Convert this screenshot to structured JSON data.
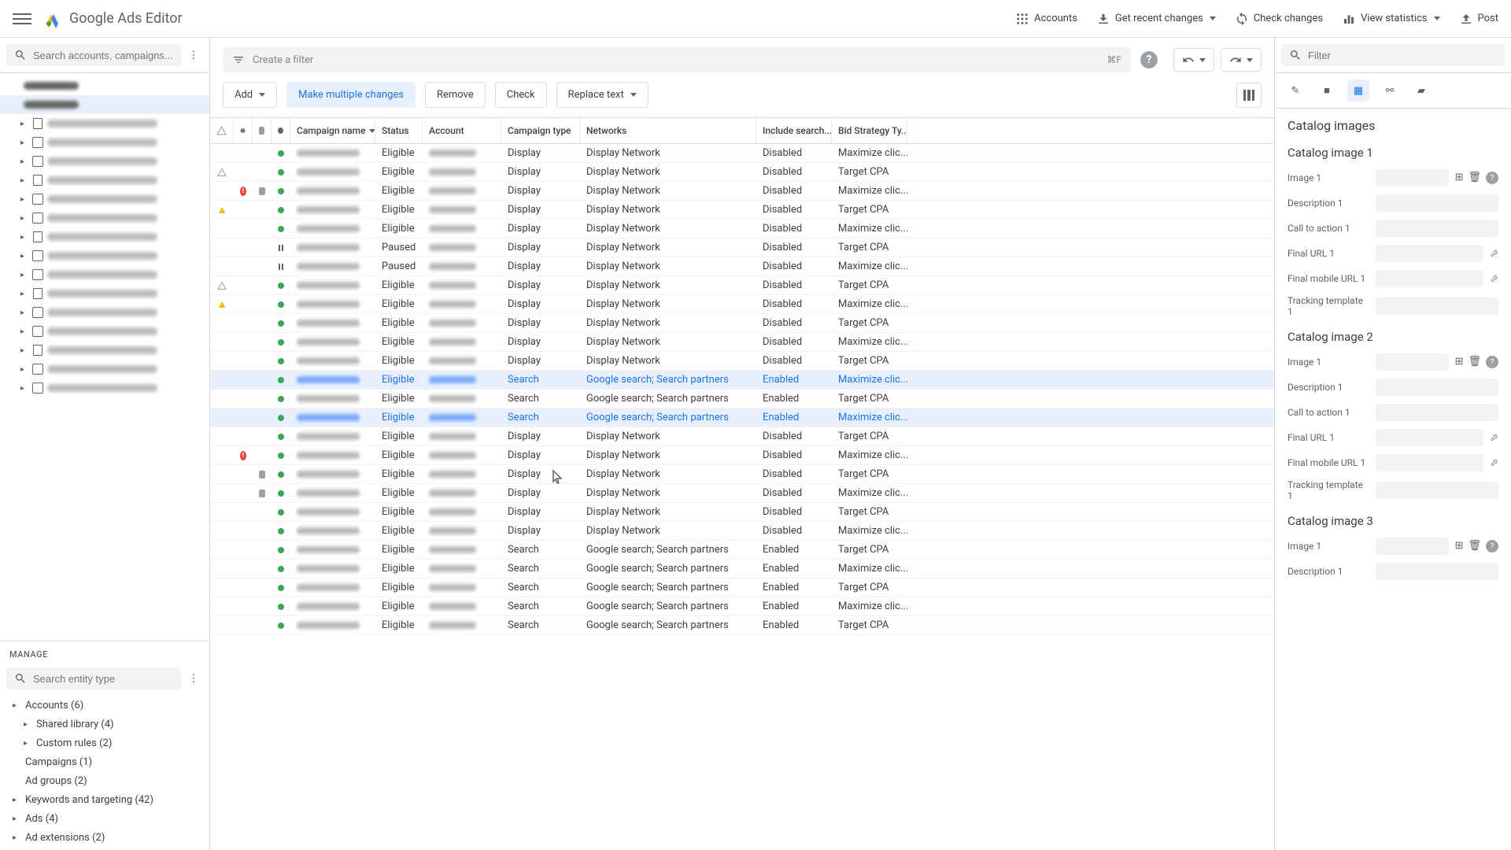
{
  "header": {
    "app_title": "Google Ads Editor",
    "accounts": "Accounts",
    "get_recent": "Get recent changes",
    "check_changes": "Check changes",
    "view_stats": "View statistics",
    "post": "Post"
  },
  "sidebar": {
    "search_placeholder": "Search accounts, campaigns...",
    "manage_header": "MANAGE",
    "entity_search_placeholder": "Search entity type",
    "items": [
      {
        "label": "Accounts (6)",
        "expandable": true
      },
      {
        "label": "Shared library (4)",
        "child": true,
        "expandable": true
      },
      {
        "label": "Custom rules (2)",
        "child": true,
        "expandable": true
      },
      {
        "label": "Campaigns (1)",
        "expandable": false
      },
      {
        "label": "Ad groups (2)",
        "expandable": false
      },
      {
        "label": "Keywords and targeting (42)",
        "expandable": true
      },
      {
        "label": "Ads (4)",
        "expandable": true
      },
      {
        "label": "Ad extensions (2)",
        "expandable": true
      }
    ]
  },
  "filter": {
    "placeholder": "Create a filter",
    "shortcut": "⌘F"
  },
  "toolbar": {
    "add": "Add",
    "make_multiple": "Make multiple changes",
    "remove": "Remove",
    "check": "Check",
    "replace": "Replace text"
  },
  "columns": {
    "campaign_name": "Campaign name",
    "status": "Status",
    "account": "Account",
    "campaign_type": "Campaign type",
    "networks": "Networks",
    "include_search": "Include search...",
    "bid_strategy": "Bid Strategy Ty..."
  },
  "rows": [
    {
      "warn": "",
      "err": "",
      "comment": "",
      "state": "dot",
      "status": "Eligible",
      "type": "Display",
      "networks": "Display Network",
      "search": "Disabled",
      "bid": "Maximize clic...",
      "selected": false
    },
    {
      "warn": "outline",
      "err": "",
      "comment": "",
      "state": "dot",
      "status": "Eligible",
      "type": "Display",
      "networks": "Display Network",
      "search": "Disabled",
      "bid": "Target CPA",
      "selected": false
    },
    {
      "warn": "",
      "err": "err",
      "comment": "yes",
      "state": "dot",
      "status": "Eligible",
      "type": "Display",
      "networks": "Display Network",
      "search": "Disabled",
      "bid": "Maximize clic...",
      "selected": false
    },
    {
      "warn": "warn",
      "err": "",
      "comment": "",
      "state": "dot",
      "status": "Eligible",
      "type": "Display",
      "networks": "Display Network",
      "search": "Disabled",
      "bid": "Target CPA",
      "selected": false
    },
    {
      "warn": "",
      "err": "",
      "comment": "",
      "state": "dot",
      "status": "Eligible",
      "type": "Display",
      "networks": "Display Network",
      "search": "Disabled",
      "bid": "Maximize clic...",
      "selected": false
    },
    {
      "warn": "",
      "err": "",
      "comment": "",
      "state": "pause",
      "status": "Paused",
      "type": "Display",
      "networks": "Display Network",
      "search": "Disabled",
      "bid": "Target CPA",
      "selected": false
    },
    {
      "warn": "",
      "err": "",
      "comment": "",
      "state": "pause",
      "status": "Paused",
      "type": "Display",
      "networks": "Display Network",
      "search": "Disabled",
      "bid": "Maximize clic...",
      "selected": false
    },
    {
      "warn": "outline",
      "err": "",
      "comment": "",
      "state": "dot",
      "status": "Eligible",
      "type": "Display",
      "networks": "Display Network",
      "search": "Disabled",
      "bid": "Target CPA",
      "selected": false
    },
    {
      "warn": "warn",
      "err": "",
      "comment": "",
      "state": "dot",
      "status": "Eligible",
      "type": "Display",
      "networks": "Display Network",
      "search": "Disabled",
      "bid": "Maximize clic...",
      "selected": false
    },
    {
      "warn": "",
      "err": "",
      "comment": "",
      "state": "dot",
      "status": "Eligible",
      "type": "Display",
      "networks": "Display Network",
      "search": "Disabled",
      "bid": "Target CPA",
      "selected": false
    },
    {
      "warn": "",
      "err": "",
      "comment": "",
      "state": "dot",
      "status": "Eligible",
      "type": "Display",
      "networks": "Display Network",
      "search": "Disabled",
      "bid": "Maximize clic...",
      "selected": false
    },
    {
      "warn": "",
      "err": "",
      "comment": "",
      "state": "dot",
      "status": "Eligible",
      "type": "Display",
      "networks": "Display Network",
      "search": "Disabled",
      "bid": "Target CPA",
      "selected": false
    },
    {
      "warn": "",
      "err": "",
      "comment": "",
      "state": "dot",
      "status": "Eligible",
      "type": "Search",
      "networks": "Google search; Search partners",
      "search": "Enabled",
      "bid": "Maximize clic...",
      "selected": true
    },
    {
      "warn": "",
      "err": "",
      "comment": "",
      "state": "dot",
      "status": "Eligible",
      "type": "Search",
      "networks": "Google search; Search partners",
      "search": "Enabled",
      "bid": "Target CPA",
      "selected": false
    },
    {
      "warn": "",
      "err": "",
      "comment": "",
      "state": "dot",
      "status": "Eligible",
      "type": "Search",
      "networks": "Google search; Search partners",
      "search": "Enabled",
      "bid": "Maximize clic...",
      "selected": true
    },
    {
      "warn": "",
      "err": "",
      "comment": "",
      "state": "dot",
      "status": "Eligible",
      "type": "Display",
      "networks": "Display Network",
      "search": "Disabled",
      "bid": "Target CPA",
      "selected": false
    },
    {
      "warn": "",
      "err": "err",
      "comment": "",
      "state": "dot",
      "status": "Eligible",
      "type": "Display",
      "networks": "Display Network",
      "search": "Disabled",
      "bid": "Maximize clic...",
      "selected": false
    },
    {
      "warn": "",
      "err": "",
      "comment": "yes",
      "state": "dot",
      "status": "Eligible",
      "type": "Display",
      "networks": "Display Network",
      "search": "Disabled",
      "bid": "Target CPA",
      "selected": false
    },
    {
      "warn": "",
      "err": "",
      "comment": "yes",
      "state": "dot",
      "status": "Eligible",
      "type": "Display",
      "networks": "Display Network",
      "search": "Disabled",
      "bid": "Maximize clic...",
      "selected": false
    },
    {
      "warn": "",
      "err": "",
      "comment": "",
      "state": "dot",
      "status": "Eligible",
      "type": "Display",
      "networks": "Display Network",
      "search": "Disabled",
      "bid": "Target CPA",
      "selected": false
    },
    {
      "warn": "",
      "err": "",
      "comment": "",
      "state": "dot",
      "status": "Eligible",
      "type": "Display",
      "networks": "Display Network",
      "search": "Disabled",
      "bid": "Maximize clic...",
      "selected": false
    },
    {
      "warn": "",
      "err": "",
      "comment": "",
      "state": "dot",
      "status": "Eligible",
      "type": "Search",
      "networks": "Google search; Search partners",
      "search": "Enabled",
      "bid": "Target CPA",
      "selected": false
    },
    {
      "warn": "",
      "err": "",
      "comment": "",
      "state": "dot",
      "status": "Eligible",
      "type": "Search",
      "networks": "Google search; Search partners",
      "search": "Enabled",
      "bid": "Maximize clic...",
      "selected": false
    },
    {
      "warn": "",
      "err": "",
      "comment": "",
      "state": "dot",
      "status": "Eligible",
      "type": "Search",
      "networks": "Google search; Search partners",
      "search": "Enabled",
      "bid": "Target CPA",
      "selected": false
    },
    {
      "warn": "",
      "err": "",
      "comment": "",
      "state": "dot",
      "status": "Eligible",
      "type": "Search",
      "networks": "Google search; Search partners",
      "search": "Enabled",
      "bid": "Maximize clic...",
      "selected": false
    },
    {
      "warn": "",
      "err": "",
      "comment": "",
      "state": "dot",
      "status": "Eligible",
      "type": "Search",
      "networks": "Google search; Search partners",
      "search": "Enabled",
      "bid": "Target CPA",
      "selected": false
    }
  ],
  "rightpanel": {
    "filter_placeholder": "Filter",
    "title": "Catalog images",
    "sections": [
      {
        "title": "Catalog image 1",
        "fields": [
          {
            "label": "Image 1",
            "actions": true
          },
          {
            "label": "Description 1"
          },
          {
            "label": "Call to action 1"
          },
          {
            "label": "Final URL 1",
            "launch": true
          },
          {
            "label": "Final mobile URL 1",
            "launch": true
          },
          {
            "label": "Tracking template 1"
          }
        ]
      },
      {
        "title": "Catalog image 2",
        "fields": [
          {
            "label": "Image 1",
            "actions": true
          },
          {
            "label": "Description 1"
          },
          {
            "label": "Call to action 1"
          },
          {
            "label": "Final URL 1",
            "launch": true
          },
          {
            "label": "Final mobile URL 1",
            "launch": true
          },
          {
            "label": "Tracking template 1"
          }
        ]
      },
      {
        "title": "Catalog image 3",
        "fields": [
          {
            "label": "Image 1",
            "actions": true
          },
          {
            "label": "Description 1"
          }
        ]
      }
    ]
  }
}
